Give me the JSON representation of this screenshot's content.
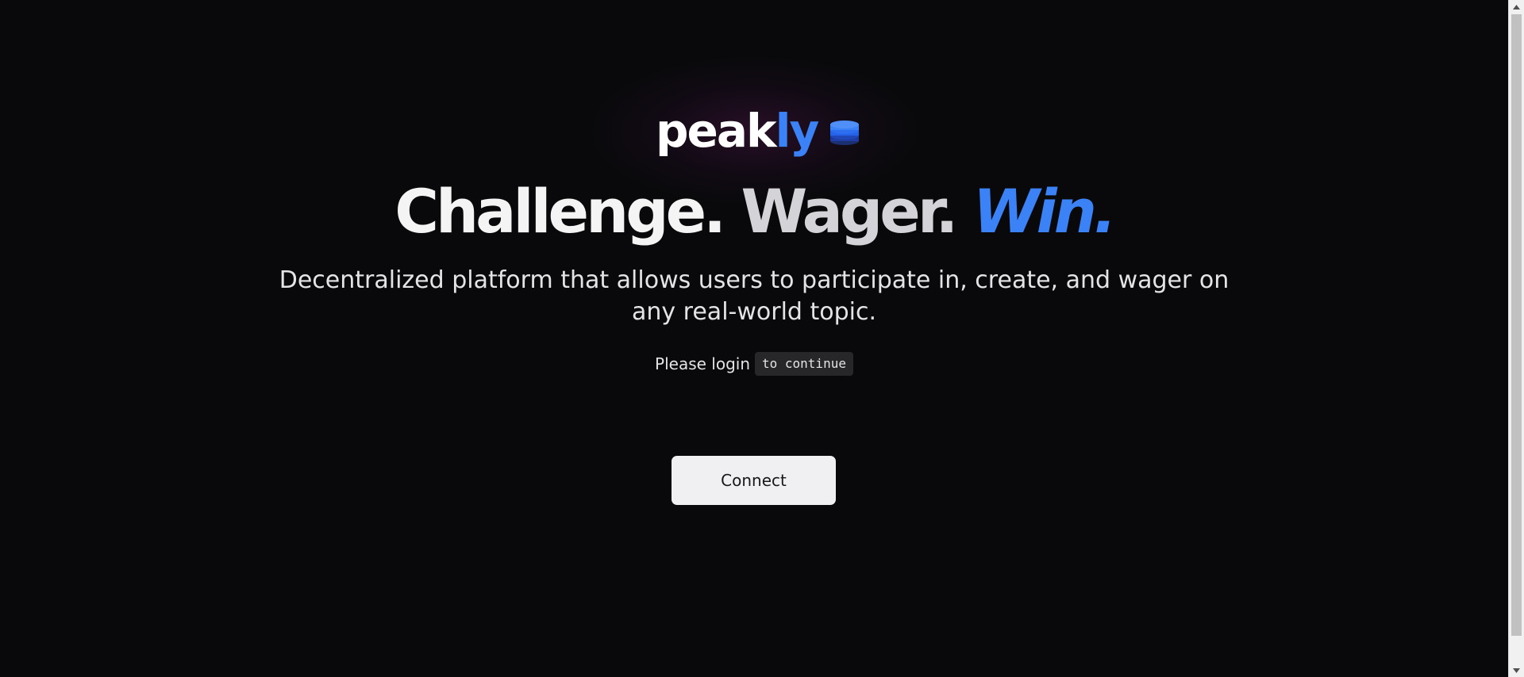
{
  "brand": {
    "name_main": "peak",
    "name_accent": "ly",
    "icon": "coin-stack-icon",
    "accent_color": "#3b82f6"
  },
  "hero": {
    "headline_part1": "Challenge.",
    "headline_part2": "Wager.",
    "headline_part3": "Win.",
    "subtitle": "Decentralized platform that allows users to participate in, create, and wager on any real-world topic."
  },
  "login": {
    "prompt_text": "Please login",
    "prompt_code": "to continue"
  },
  "actions": {
    "connect_label": "Connect"
  },
  "colors": {
    "background": "#09090b",
    "accent": "#3b82f6",
    "button_bg": "#f0f0f2"
  }
}
